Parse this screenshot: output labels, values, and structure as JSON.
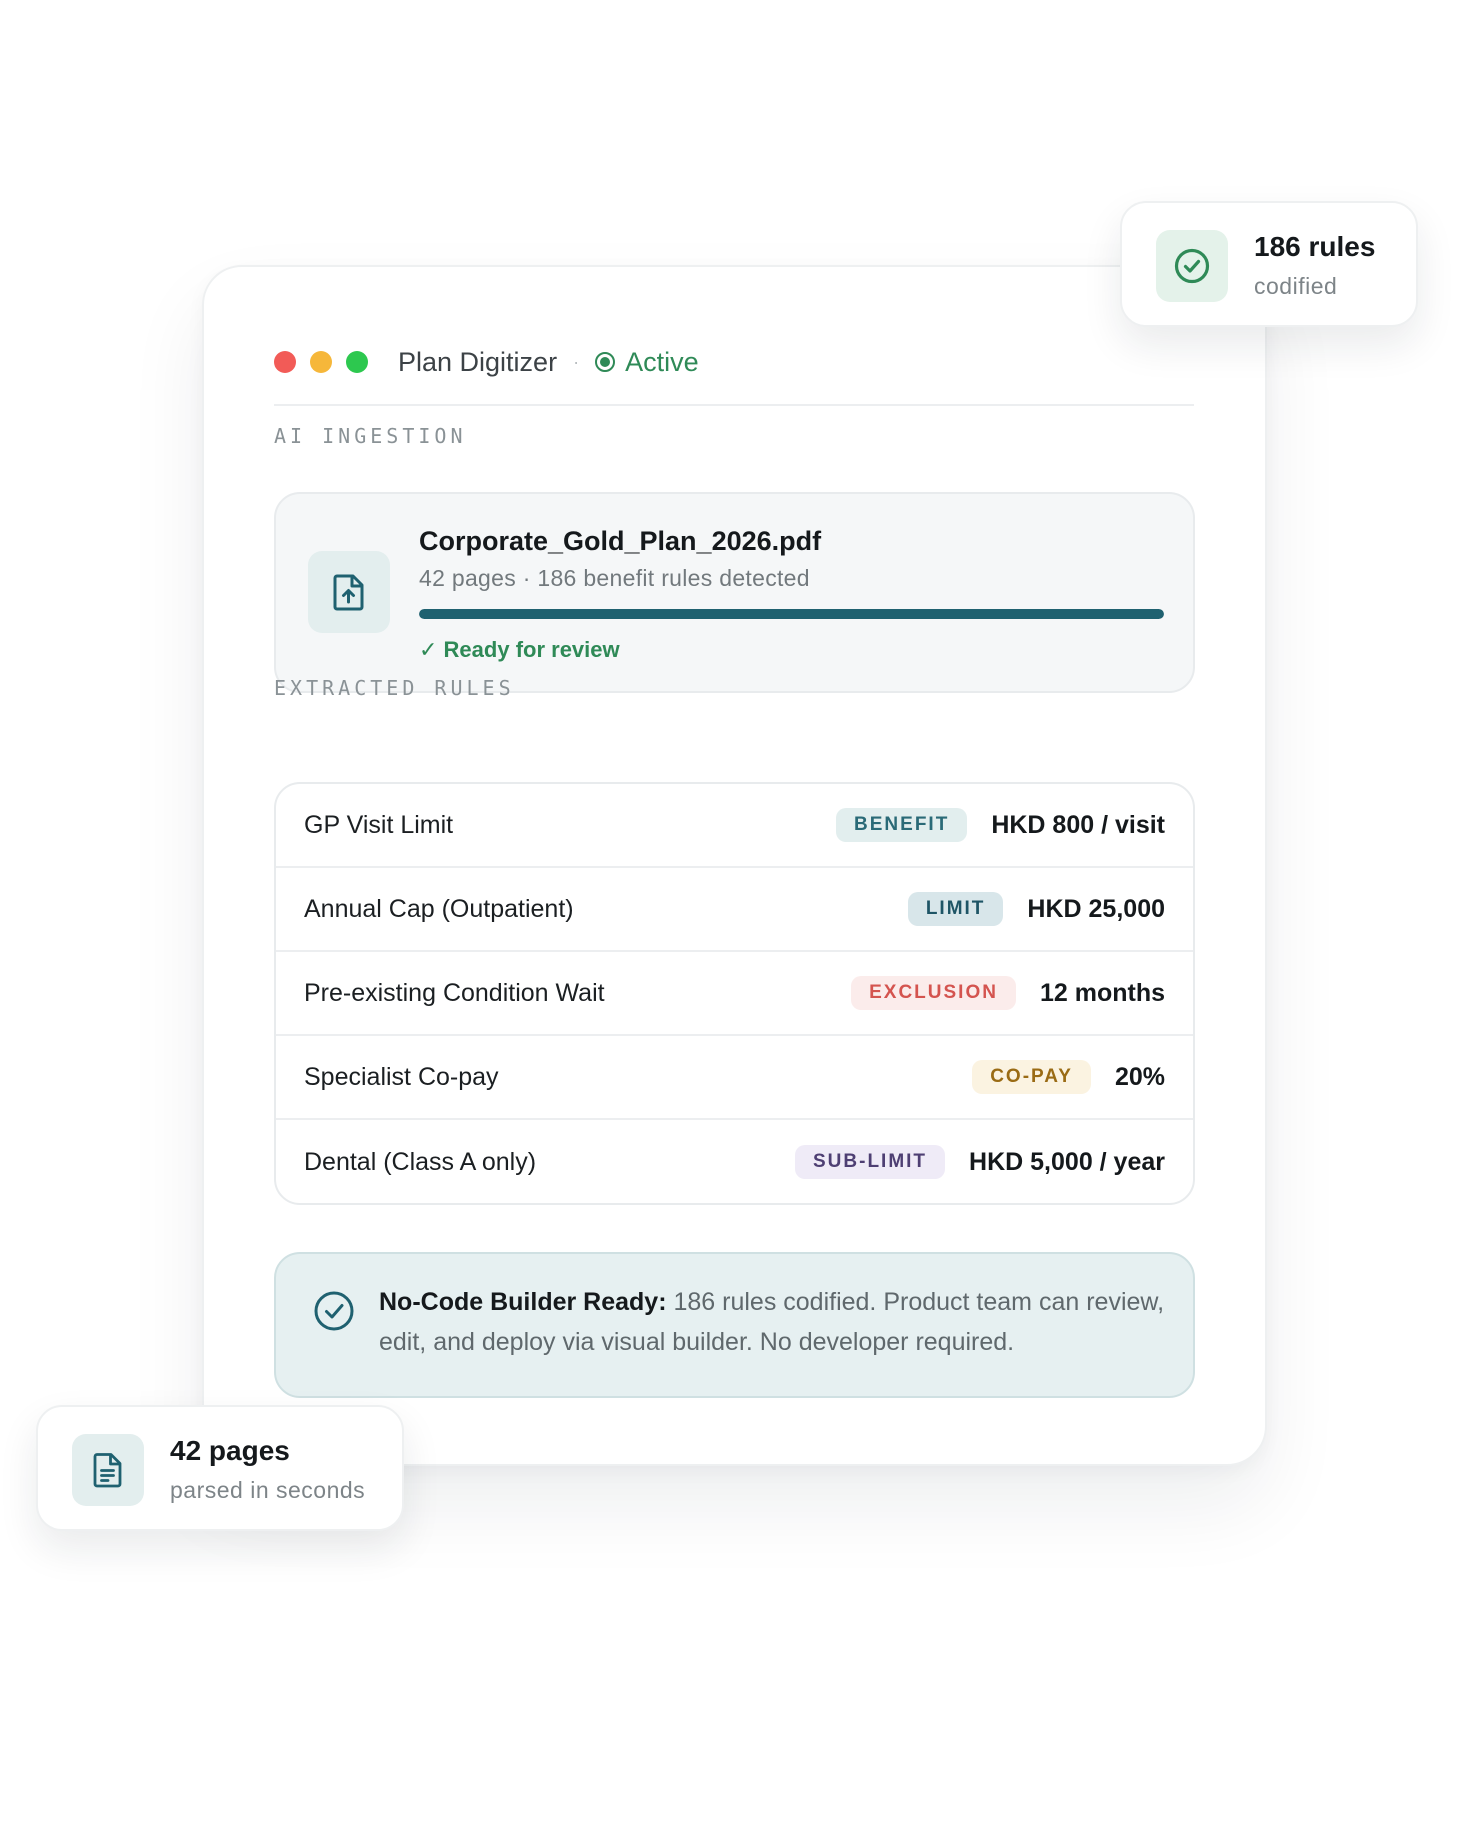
{
  "window": {
    "title": "Plan Digitizer",
    "status": "Active"
  },
  "ingestion": {
    "section_label": "AI INGESTION",
    "file_name": "Corporate_Gold_Plan_2026.pdf",
    "file_meta": "42 pages · 186 benefit rules detected",
    "progress": 1.0,
    "status": "✓ Ready for review"
  },
  "rules": {
    "section_label": "EXTRACTED RULES",
    "items": [
      {
        "name": "GP Visit Limit",
        "badge": "BENEFIT",
        "value": "HKD 800 / visit"
      },
      {
        "name": "Annual Cap (Outpatient)",
        "badge": "LIMIT",
        "value": "HKD 25,000"
      },
      {
        "name": "Pre-existing Condition Wait",
        "badge": "EXCLUSION",
        "value": "12 months"
      },
      {
        "name": "Specialist Co-pay",
        "badge": "CO-PAY",
        "value": "20%"
      },
      {
        "name": "Dental (Class A only)",
        "badge": "SUB-LIMIT",
        "value": "HKD 5,000 / year"
      }
    ]
  },
  "notice": {
    "title": "No-Code Builder Ready:",
    "body": " 186 rules codified. Product team can review, edit, and deploy via visual builder. No developer required."
  },
  "badges": {
    "rules_title": "186 rules",
    "rules_sub": "codified",
    "pages_title": "42 pages",
    "pages_sub": "parsed in seconds"
  },
  "colors": {
    "accent": "#1f6170",
    "active_green": "#2f8a57"
  }
}
